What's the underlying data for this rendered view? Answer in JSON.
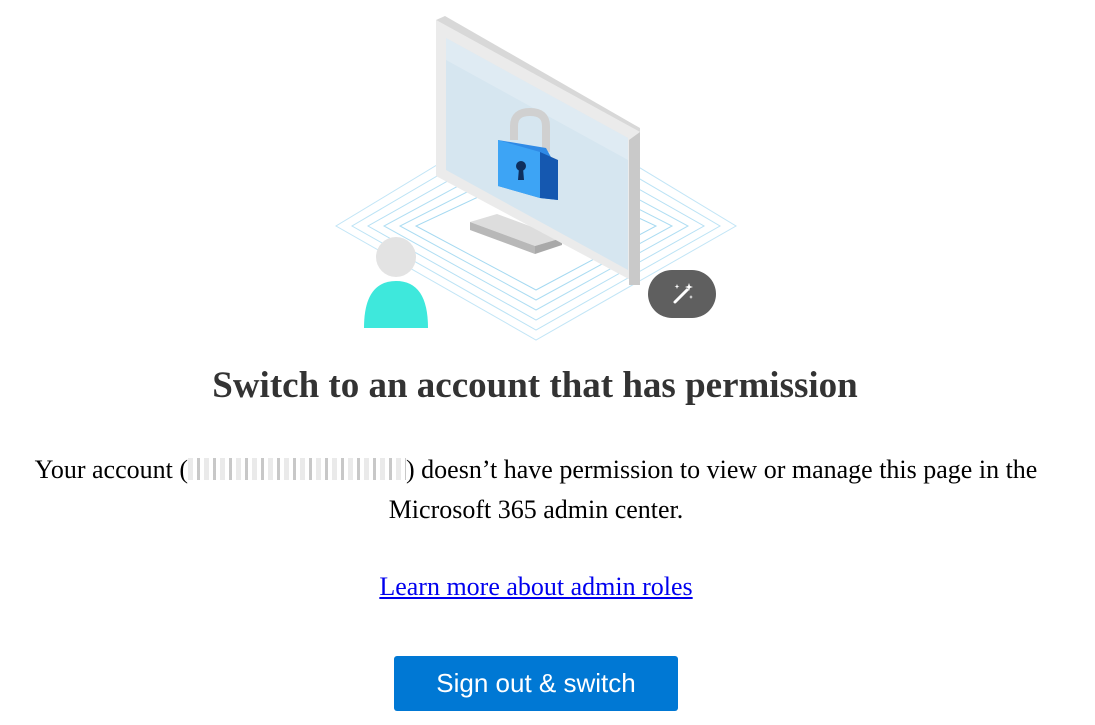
{
  "page": {
    "title": "Switch to an account that has permission",
    "message_prefix": "Your account (",
    "message_suffix": ") doesn’t have permission to view or manage this page in the Microsoft 365 admin center.",
    "learn_more_link": "Learn more about admin roles",
    "sign_out_button": "Sign out & switch"
  },
  "illustration": {
    "main_icon": "lock-on-monitor-icon",
    "person_icon": "user-avatar-icon",
    "badge_icon": "magic-wand-icon"
  },
  "colors": {
    "accent": "#0078d4",
    "title": "#333333",
    "link": "#0000ee",
    "badge": "#5f5f5f",
    "person_body": "#3ee8dc",
    "lock": "#1a72d6"
  }
}
